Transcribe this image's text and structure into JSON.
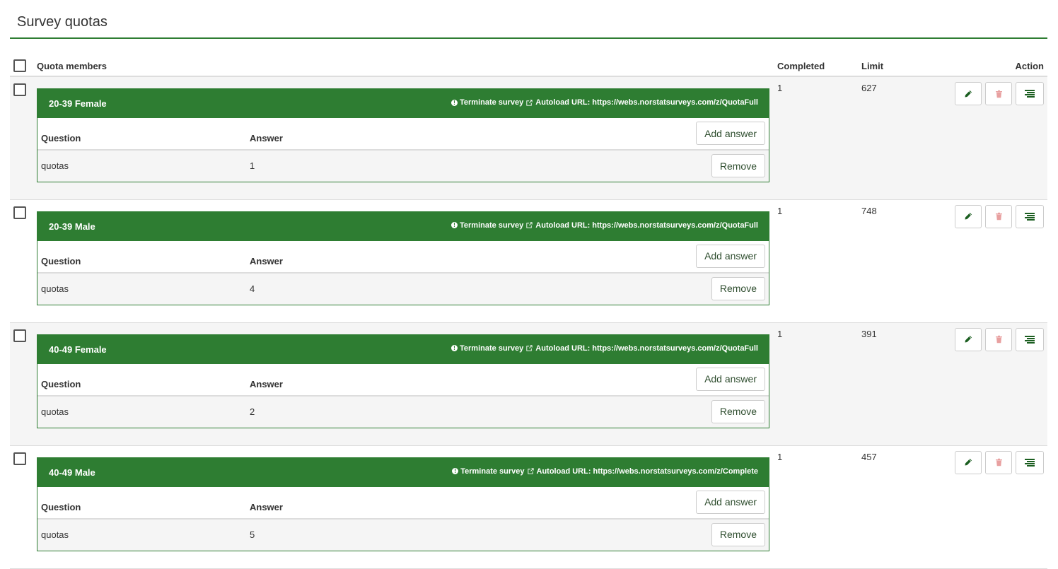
{
  "page": {
    "title": "Survey quotas"
  },
  "table": {
    "headers": {
      "members": "Quota members",
      "completed": "Completed",
      "limit": "Limit",
      "action": "Action"
    },
    "member_headers": {
      "question": "Question",
      "answer": "Answer"
    },
    "add_answer_label": "Add answer",
    "remove_label": "Remove",
    "terminate_label": "Terminate survey",
    "autoload_label": "Autoload URL:",
    "rows": [
      {
        "name": "20-39 Female",
        "url": "https://webs.norstatsurveys.com/z/QuotaFull",
        "question": "quotas",
        "answer": "1",
        "completed": "1",
        "limit": "627"
      },
      {
        "name": "20-39 Male",
        "url": "https://webs.norstatsurveys.com/z/QuotaFull",
        "question": "quotas",
        "answer": "4",
        "completed": "1",
        "limit": "748"
      },
      {
        "name": "40-49 Female",
        "url": "https://webs.norstatsurveys.com/z/QuotaFull",
        "question": "quotas",
        "answer": "2",
        "completed": "1",
        "limit": "391"
      },
      {
        "name": "40-49 Male",
        "url": "https://webs.norstatsurveys.com/z/Complete",
        "question": "quotas",
        "answer": "5",
        "completed": "1",
        "limit": "457"
      }
    ]
  },
  "colors": {
    "primary": "#2e7d32",
    "danger_light": "#e8a0a0"
  },
  "icons": {
    "edit": "pencil-icon",
    "delete": "trash-icon",
    "validation": "list-icon",
    "info": "info-circle-icon",
    "external": "external-link-icon"
  }
}
